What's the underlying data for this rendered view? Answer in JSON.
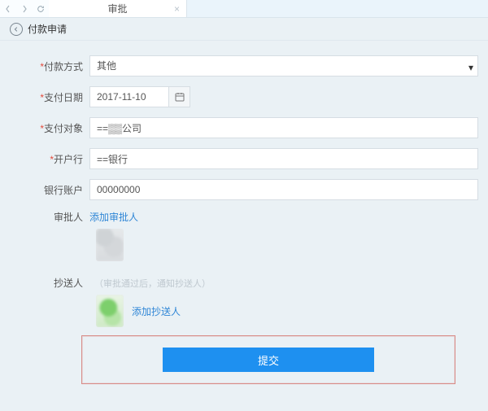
{
  "topbar": {
    "tab_label": "审批",
    "tab_close": "×"
  },
  "titlebar": {
    "title": "付款申请"
  },
  "form": {
    "pay_method": {
      "label": "付款方式",
      "value": "其他",
      "required": true
    },
    "pay_date": {
      "label": "支付日期",
      "value": "2017-11-10",
      "required": true
    },
    "pay_target": {
      "label": "支付对象",
      "value": "==▒▒公司",
      "required": true
    },
    "bank_open": {
      "label": "开户行",
      "value": "==银行",
      "required": true
    },
    "bank_acct": {
      "label": "银行账户",
      "value": "00000000",
      "required": false
    }
  },
  "approver": {
    "label": "审批人",
    "add_link": "添加审批人"
  },
  "cc": {
    "label": "抄送人",
    "hint": "（审批通过后，通知抄送人）",
    "add_link": "添加抄送人"
  },
  "submit": {
    "label": "提交"
  }
}
